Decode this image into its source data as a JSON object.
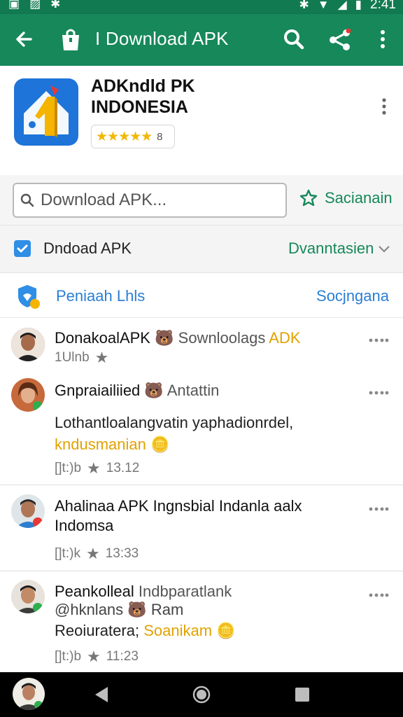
{
  "status_bar": {
    "time": "2:41"
  },
  "app_bar": {
    "title": "I Download APK"
  },
  "app_header": {
    "name_line1": "ADKndld PK",
    "name_line2": "INDONESIA",
    "stars": "★★★★★",
    "rating_count": "8"
  },
  "search": {
    "placeholder": "Download APK...",
    "save_label": "Sacianain"
  },
  "filter": {
    "label": "Dndoad APK",
    "sort_label": "Dvanntasien"
  },
  "section": {
    "label": "Peniaah Lhls",
    "right_label": "Socjngana"
  },
  "messages": [
    {
      "name": "DonakoalAPK",
      "name_extra": "Sownloolags",
      "name_gold": "ADK",
      "sub": "1Ulnb"
    },
    {
      "name": "Gnpraiailiied",
      "name_extra": "Antattin",
      "text_line1": "Lothantloalangvatin yaphadionrdel,",
      "text_line2": "kndusmanian",
      "likes": "[]t:)b",
      "time": "13.12"
    },
    {
      "name": "Ahalinaa APK Ingnsbial Indanla aalx",
      "name_line2": "Indomsa",
      "likes": "[]t:)k",
      "time": "13:33"
    },
    {
      "name": "Peankolleal",
      "name_extra": "Indbparatlank",
      "handle": "@hknlans",
      "handle_extra": "Ram",
      "text": "Reoiuratera;",
      "text_gold": "Soanikam",
      "likes": "[]t:)b",
      "time": "11:23"
    }
  ],
  "colors": {
    "app_bar": "#16885a",
    "accent_green": "#16885a",
    "link_blue": "#2a7fd4",
    "star_gold": "#f2b705"
  }
}
